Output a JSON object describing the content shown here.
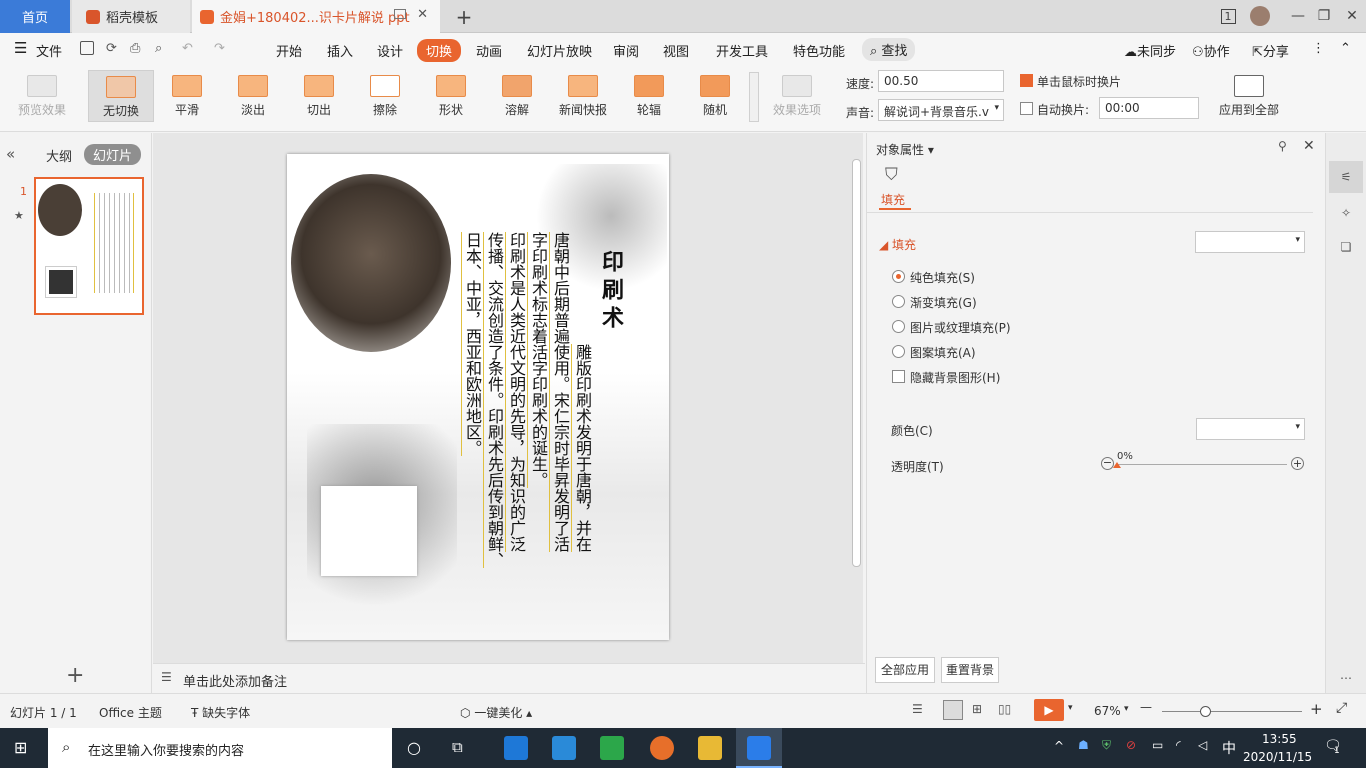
{
  "tabs": {
    "home": "首页",
    "template": "稻壳模板",
    "document": "金娟+180402...识卡片解说 ppt",
    "page_count": "1"
  },
  "menu": {
    "file": "文件",
    "items": [
      "开始",
      "插入",
      "设计",
      "切换",
      "动画",
      "幻灯片放映",
      "审阅",
      "视图",
      "开发工具",
      "特色功能"
    ],
    "search": "查找",
    "sync": "未同步",
    "collab": "协作",
    "share": "分享"
  },
  "ribbon": {
    "preview": "预览效果",
    "transitions": [
      "无切换",
      "平滑",
      "淡出",
      "切出",
      "擦除",
      "形状",
      "溶解",
      "新闻快报",
      "轮辐",
      "随机"
    ],
    "effect_options": "效果选项",
    "speed_label": "速度:",
    "speed_value": "00.50",
    "sound_label": "声音:",
    "sound_value": "解说词+背景音乐.v",
    "click_advance": "单击鼠标时换片",
    "auto_advance": "自动换片:",
    "auto_time": "00:00",
    "apply_all": "应用到全部"
  },
  "leftpanel": {
    "outline": "大纲",
    "slides": "幻灯片",
    "slide_number": "1"
  },
  "slide": {
    "title": "印刷术",
    "paragraph": "雕版印刷术发明于唐朝，并在唐朝中后期普遍使用。宋仁宗时毕昇发明了活字印刷术标志着活字印刷术的诞生。印刷术是人类近代文明的先导，为知识的广泛传播、交流创造了条件。印刷术先后传到朝鲜、日本、中亚，西亚和欧洲地区。",
    "columns": [
      "雕版印刷术发明于唐朝，并在",
      "唐朝中后期普遍使用。宋仁宗时毕昇发明了活",
      "字印刷术标志着活字印刷术的诞生。",
      "印刷术是人类近代文明的先导，为知识的广泛",
      "传播、交流创造了条件。印刷术先后传到朝鲜、",
      "日本、中亚，西亚和欧洲地区。"
    ]
  },
  "notes_placeholder": "单击此处添加备注",
  "rightpanel": {
    "title": "对象属性",
    "tab_fill": "填充",
    "section_fill": "填充",
    "options": [
      "纯色填充(S)",
      "渐变填充(G)",
      "图片或纹理填充(P)",
      "图案填充(A)"
    ],
    "hide_bg": "隐藏背景图形(H)",
    "color_label": "颜色(C)",
    "transparency_label": "透明度(T)",
    "transparency_value": "0%",
    "transparency_fraction": 0,
    "apply_all": "全部应用",
    "reset_bg": "重置背景"
  },
  "statusbar": {
    "slide_info": "幻灯片 1 / 1",
    "theme": "Office 主题",
    "missing_font": "缺失字体",
    "beautify": "一键美化",
    "zoom": "67%"
  },
  "taskbar": {
    "search_placeholder": "在这里输入你要搜索的内容",
    "ime": "中",
    "time": "13:55",
    "date": "2020/11/15",
    "notif_count": "1"
  },
  "colors": {
    "accent": "#e9652f",
    "home_tab": "#3b7bd8",
    "taskbar": "#1f2a35"
  }
}
